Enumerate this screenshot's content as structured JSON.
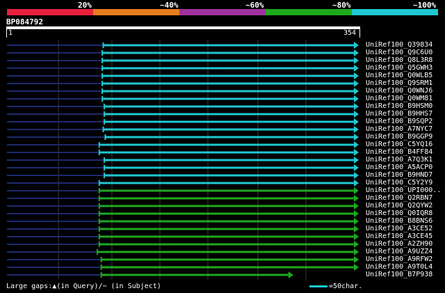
{
  "legend": {
    "labels": [
      "20%",
      "~40%",
      "~60%",
      "~80%",
      "~100%"
    ],
    "colors": [
      "#e8203c",
      "#e87d1e",
      "#a032a0",
      "#1eaa1e",
      "#1ec8d2"
    ]
  },
  "query": {
    "id": "BP084792",
    "start": "1",
    "end": "354",
    "length": 354
  },
  "hits": [
    {
      "label": "UniRef100_Q39834",
      "start": 98,
      "color": "#1ec8d2"
    },
    {
      "label": "UniRef100_Q9C6U0",
      "start": 97,
      "color": "#1ec8d2"
    },
    {
      "label": "UniRef100_Q8L3R8",
      "start": 97,
      "color": "#1ec8d2"
    },
    {
      "label": "UniRef100_Q5GWH3",
      "start": 97,
      "color": "#1ec8d2"
    },
    {
      "label": "UniRef100_Q0WLB5",
      "start": 97,
      "color": "#1ec8d2"
    },
    {
      "label": "UniRef100_Q9SRM1",
      "start": 97,
      "color": "#1ec8d2"
    },
    {
      "label": "UniRef100_Q0WNJ6",
      "start": 97,
      "color": "#1ec8d2"
    },
    {
      "label": "UniRef100_Q0WM81",
      "start": 97,
      "color": "#1ec8d2"
    },
    {
      "label": "UniRef100_B9HSM0",
      "start": 99,
      "color": "#1ec8d2"
    },
    {
      "label": "UniRef100_B9HHS7",
      "start": 99,
      "color": "#1ec8d2"
    },
    {
      "label": "UniRef100_B9SQP2",
      "start": 99,
      "color": "#1ec8d2"
    },
    {
      "label": "UniRef100_A7NYC7",
      "start": 98,
      "color": "#1ec8d2"
    },
    {
      "label": "UniRef100_B9GGP9",
      "start": 100,
      "color": "#1ec8d2"
    },
    {
      "label": "UniRef100_C5YQ16",
      "start": 94,
      "color": "#1ec8d2"
    },
    {
      "label": "UniRef100_B4FF84",
      "start": 94,
      "color": "#1ec8d2"
    },
    {
      "label": "UniRef100_A7Q3K1",
      "start": 99,
      "color": "#1ec8d2"
    },
    {
      "label": "UniRef100_A5ACP0",
      "start": 99,
      "color": "#1ec8d2"
    },
    {
      "label": "UniRef100_B9HND7",
      "start": 99,
      "color": "#1ec8d2"
    },
    {
      "label": "UniRef100_C5Y2Y9",
      "start": 94,
      "color": "#1ec8d2"
    },
    {
      "label": "UniRef100_UPI000..",
      "start": 94,
      "color": "#1eaa1e"
    },
    {
      "label": "UniRef100_Q2RBN7",
      "start": 94,
      "color": "#1eaa1e"
    },
    {
      "label": "UniRef100_Q2QYW2",
      "start": 94,
      "color": "#1eaa1e"
    },
    {
      "label": "UniRef100_Q0IQR8",
      "start": 94,
      "color": "#1eaa1e"
    },
    {
      "label": "UniRef100_B8BNS6",
      "start": 94,
      "color": "#1eaa1e"
    },
    {
      "label": "UniRef100_A3CE52",
      "start": 94,
      "color": "#1eaa1e"
    },
    {
      "label": "UniRef100_A3CE45",
      "start": 94,
      "color": "#1eaa1e"
    },
    {
      "label": "UniRef100_A2ZH90",
      "start": 94,
      "color": "#1eaa1e"
    },
    {
      "label": "UniRef100_A9UZZ4",
      "start": 92,
      "color": "#1eaa1e"
    },
    {
      "label": "UniRef100_A9RFW2",
      "start": 96,
      "color": "#1eaa1e"
    },
    {
      "label": "UniRef100_A9T0L4",
      "start": 96,
      "color": "#1eaa1e"
    },
    {
      "label": "UniRef100_B7P938",
      "start": 96,
      "end": 288,
      "color": "#1eaa1e"
    }
  ],
  "footer": {
    "gaps_text": "Large gaps:▲(in Query)/− (in Subject)",
    "scale_text": "=50char."
  }
}
